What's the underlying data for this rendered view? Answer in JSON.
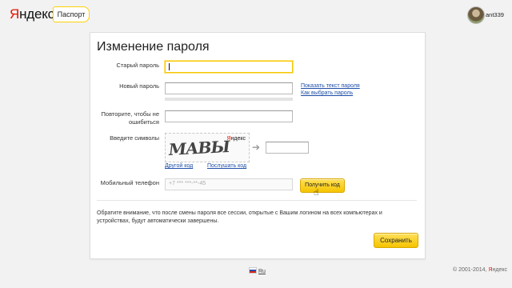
{
  "header": {
    "logo_ya": "Я",
    "logo_rest": "ндекс",
    "service_tab": "Паспорт",
    "username": "ant339"
  },
  "form": {
    "title": "Изменение пароля",
    "old_password": {
      "label": "Старый пароль",
      "value": ""
    },
    "new_password": {
      "label": "Новый пароль",
      "value": "",
      "show_text_link": "Показать текст пароля",
      "how_to_choose_link": "Как выбрать пароль"
    },
    "repeat_password": {
      "label": "Повторите, чтобы не ошибиться",
      "value": ""
    },
    "captcha": {
      "label": "Введите символы",
      "image_text": "МАВЫ",
      "brand_ya": "Я",
      "brand_rest": "ндекс",
      "value": "",
      "other_code_link": "Другой код",
      "listen_code_link": "Послушать код"
    },
    "phone": {
      "label": "Мобильный телефон",
      "placeholder": "+7 *** ***-**-45",
      "get_code_button": "Получить код"
    },
    "note": "Обратите внимание, что после смены пароля все сессии, открытые с Вашим логином на всех компьютерах и устройствах, будут автоматически завершены.",
    "save_button": "Сохранить"
  },
  "footer": {
    "language": "Ru",
    "copyright_prefix": "© 2001-2014,",
    "copyright_ya": "Я",
    "copyright_rest": "ндекс"
  },
  "colors": {
    "brand_red": "#e61400",
    "accent_yellow": "#ffd200",
    "link_blue": "#1f4fa8"
  }
}
